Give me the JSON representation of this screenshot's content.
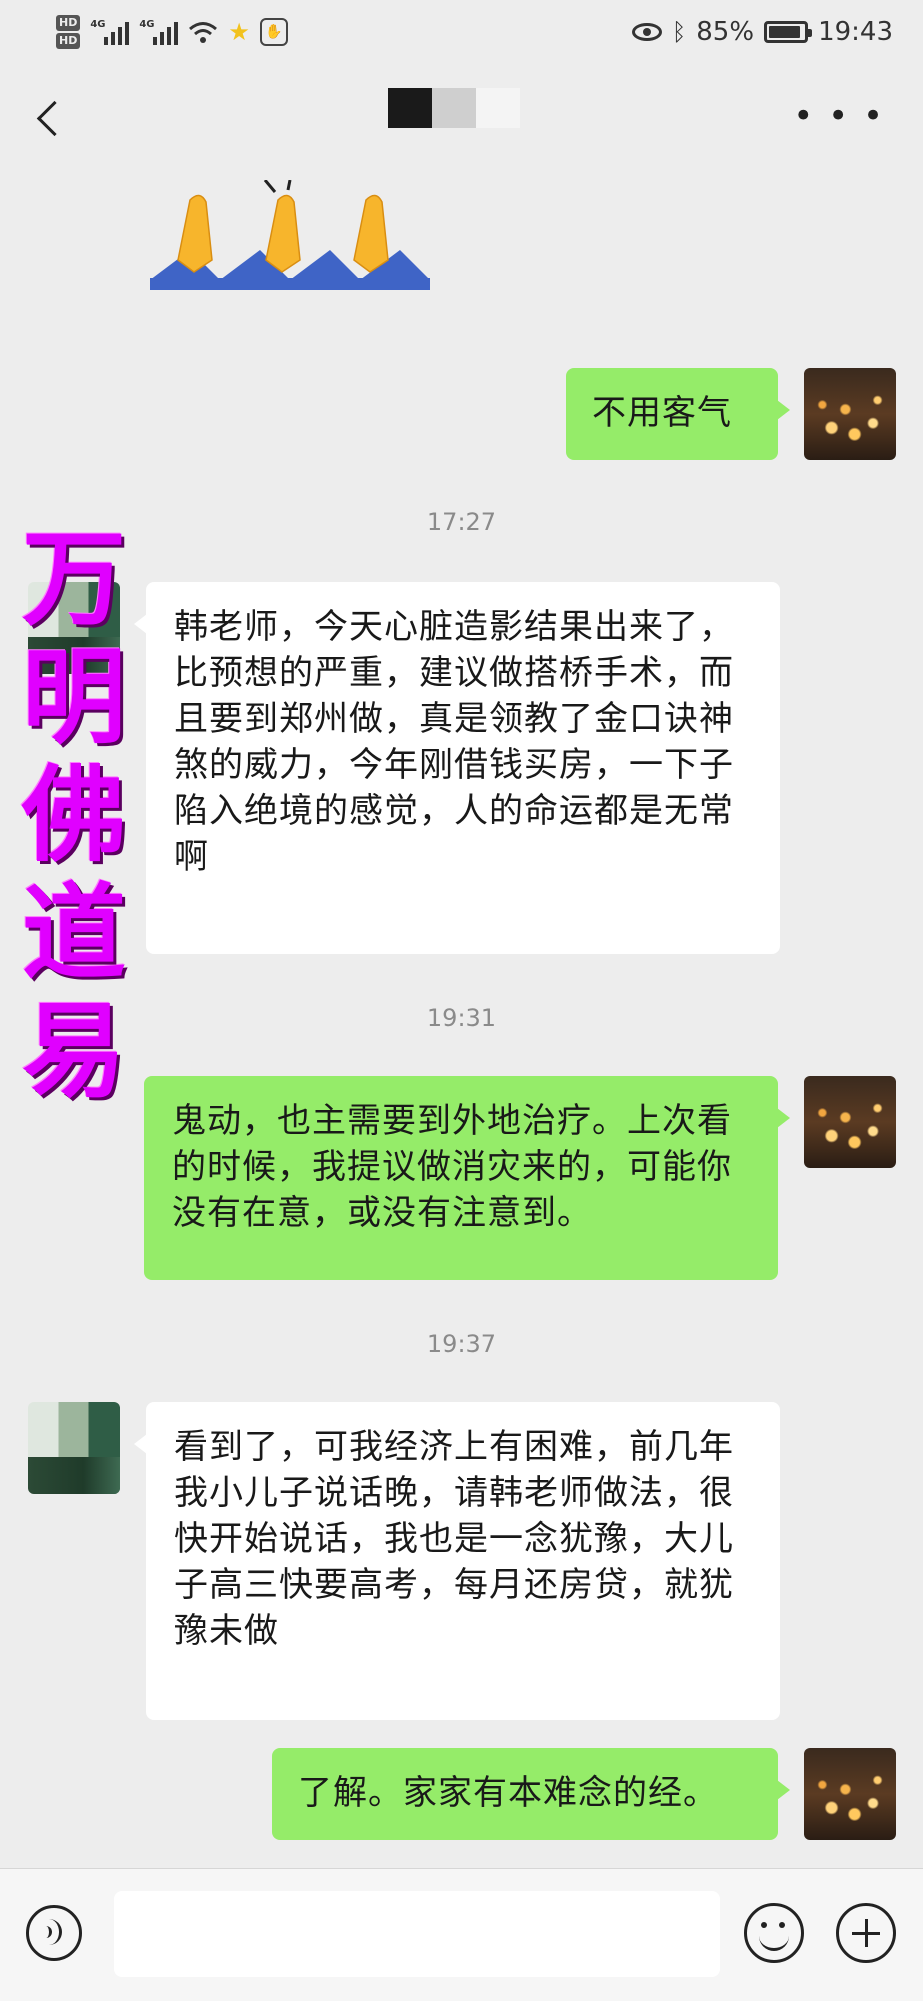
{
  "status_bar": {
    "hd1": "HD",
    "hd2": "HD",
    "net1": "4G",
    "net2": "4G",
    "battery": "85%",
    "time": "19:43"
  },
  "messages": [
    {
      "type": "time",
      "text": "17:27"
    },
    {
      "type": "time",
      "text": "19:31"
    },
    {
      "type": "time",
      "text": "19:37"
    }
  ],
  "bubbles": {
    "m1": "不用客气",
    "m2": "韩老师，今天心脏造影结果出来了，比预想的严重，建议做搭桥手术，而且要到郑州做，真是领教了金口诀神煞的威力，今年刚借钱买房，一下子陷入绝境的感觉，人的命运都是无常啊",
    "m3": "鬼动，也主需要到外地治疗。上次看的时候，我提议做消灾来的，可能你没有在意，或没有注意到。",
    "m4": "看到了，可我经济上有困难，前几年我小儿子说话晚，请韩老师做法，很快开始说话，我也是一念犹豫，大儿子高三快要高考，每月还房贷，就犹豫未做",
    "m5": "了解。家家有本难念的经。"
  },
  "watermark": [
    "万",
    "明",
    "佛",
    "道",
    "易"
  ],
  "colors": {
    "my_bubble": "#95ec69",
    "other_bubble": "#ffffff",
    "background": "#ededed",
    "watermark": "#e000ff"
  }
}
